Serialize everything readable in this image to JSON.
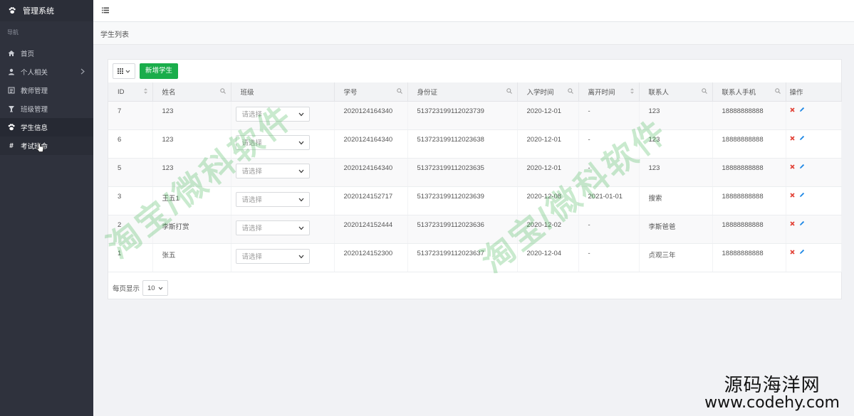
{
  "app": {
    "title": "管理系统"
  },
  "sidebar": {
    "section_label": "导航",
    "items": [
      {
        "label": "首页",
        "icon": "home-icon"
      },
      {
        "label": "个人相关",
        "icon": "user-icon"
      },
      {
        "label": "教师管理",
        "icon": "list-icon"
      },
      {
        "label": "班级管理",
        "icon": "trophy-icon"
      },
      {
        "label": "学生信息",
        "icon": "users-icon"
      },
      {
        "label": "考试班命",
        "icon": "hash-icon"
      }
    ]
  },
  "page": {
    "title": "学生列表"
  },
  "toolbar": {
    "add_label": "新增学生"
  },
  "table": {
    "headers": [
      "ID",
      "姓名",
      "班级",
      "学号",
      "身份证",
      "入学时间",
      "离开时间",
      "联系人",
      "联系人手机",
      "操作"
    ],
    "rows": [
      {
        "id": "7",
        "name": "123",
        "class": "请选择",
        "student_no": "2020124164340",
        "id_card": "513723199112023739",
        "enroll": "2020-12-01",
        "leave": "-",
        "contact": "123",
        "phone": "18888888888"
      },
      {
        "id": "6",
        "name": "123",
        "class": "请选择",
        "student_no": "2020124164340",
        "id_card": "513723199112023638",
        "enroll": "2020-12-01",
        "leave": "-",
        "contact": "123",
        "phone": "18888888888"
      },
      {
        "id": "5",
        "name": "123",
        "class": "请选择",
        "student_no": "2020124164340",
        "id_card": "513723199112023635",
        "enroll": "2020-12-01",
        "leave": "-",
        "contact": "123",
        "phone": "18888888888"
      },
      {
        "id": "3",
        "name": "王五1",
        "class": "请选择",
        "student_no": "2020124152717",
        "id_card": "513723199112023639",
        "enroll": "2020-12-08",
        "leave": "2021-01-01",
        "contact": "搜索",
        "phone": "18888888888"
      },
      {
        "id": "2",
        "name": "李斯打赏",
        "class": "请选择",
        "student_no": "2020124152444",
        "id_card": "513723199112023636",
        "enroll": "2020-12-02",
        "leave": "-",
        "contact": "李斯爸爸",
        "phone": "18888888888"
      },
      {
        "id": "1",
        "name": "张五",
        "class": "请选择",
        "student_no": "2020124152300",
        "id_card": "513723199112023637",
        "enroll": "2020-12-04",
        "leave": "-",
        "contact": "贞观三年",
        "phone": "18888888888"
      }
    ]
  },
  "pagination": {
    "per_page_label": "每页显示",
    "page_size": "10"
  },
  "watermark": {
    "text": "淘宝/微科软件"
  },
  "corner_brand": {
    "line1": "源码海洋网",
    "line2": "www.codehy.com"
  },
  "colors": {
    "sidebar": "#2f323d",
    "primary": "#1aad4b",
    "delete": "#e2453a",
    "edit": "#1e88e5"
  }
}
